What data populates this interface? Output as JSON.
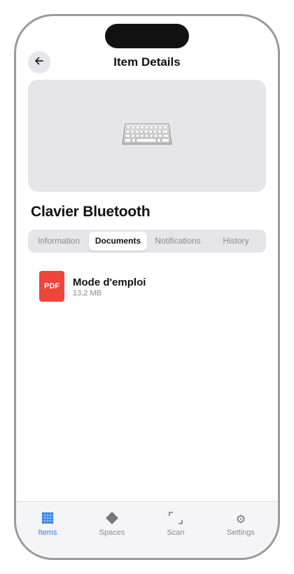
{
  "header": {
    "title": "Item Details",
    "back_icon": "arrow-left-icon"
  },
  "item": {
    "name": "Clavier Bluetooth",
    "image_icon": "keyboard-icon"
  },
  "segments": [
    {
      "label": "Information",
      "active": false
    },
    {
      "label": "Documents",
      "active": true
    },
    {
      "label": "Notifications",
      "active": false
    },
    {
      "label": "History",
      "active": false
    }
  ],
  "documents": [
    {
      "badge": "PDF",
      "name": "Mode d'emploi",
      "size": "13,2 MB",
      "icon": "pdf-file-icon"
    }
  ],
  "tabbar": [
    {
      "label": "Items",
      "icon": "grid-icon",
      "active": true
    },
    {
      "label": "Spaces",
      "icon": "diamond-icon",
      "active": false
    },
    {
      "label": "Scan",
      "icon": "scan-frame-icon",
      "active": false
    },
    {
      "label": "Settings",
      "icon": "gear-icon",
      "active": false
    }
  ],
  "colors": {
    "accent": "#2f80ed",
    "pdf_red": "#f0453a",
    "segment_bg": "#e5e5ea"
  }
}
